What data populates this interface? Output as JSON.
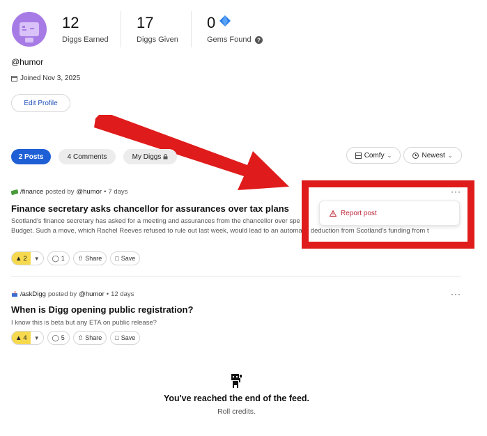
{
  "profile": {
    "handle": "@humor",
    "joined": "Joined Nov 3, 2025",
    "edit_label": "Edit Profile",
    "stats": [
      {
        "value": "12",
        "label": "Diggs Earned"
      },
      {
        "value": "17",
        "label": "Diggs Given"
      },
      {
        "value": "0",
        "label": "Gems Found"
      }
    ]
  },
  "tabs": [
    {
      "label": "2 Posts",
      "active": true
    },
    {
      "label": "4 Comments",
      "active": false
    },
    {
      "label": "My Diggs",
      "active": false
    }
  ],
  "view_controls": {
    "density": "Comfy",
    "sort": "Newest"
  },
  "posts": [
    {
      "community": "/finance",
      "posted_by": "posted by",
      "author": "@humor",
      "age": "7 days",
      "title": "Finance secretary asks chancellor for assurances over tax plans",
      "body_1": "Scotland's finance secretary has asked for a meeting and assurances from the chancellor over spe",
      "body_2": "Budget. Such a move, which Rachel Reeves refused to rule out last week, would lead to an automatic deduction from Scotland's funding from t",
      "votes": "2",
      "comments": "1",
      "share": "Share",
      "save": "Save"
    },
    {
      "community": "/askDigg",
      "posted_by": "posted by",
      "author": "@humor",
      "age": "12 days",
      "title": "When is Digg opening public registration?",
      "body_1": "I know this is beta but any ETA on public release?",
      "votes": "4",
      "comments": "5",
      "share": "Share",
      "save": "Save"
    }
  ],
  "menu": {
    "report_label": "Report post"
  },
  "feed_end": {
    "title": "You've reached the end of the feed.",
    "subtitle": "Roll credits."
  },
  "colors": {
    "annotation_red": "#e01b1b",
    "primary_blue": "#1f5fd6",
    "avatar_purple": "#a77be6",
    "upvote_yellow": "#f6d94e"
  }
}
